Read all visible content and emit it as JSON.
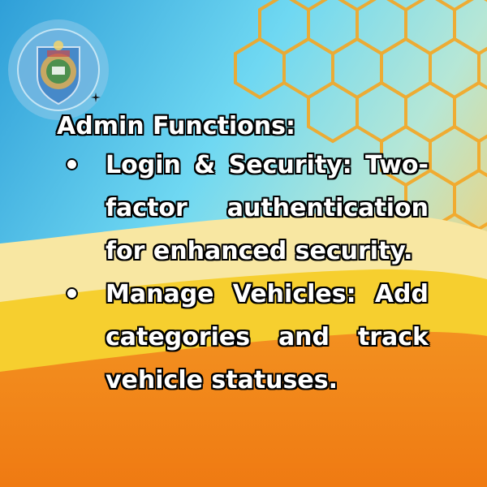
{
  "slide": {
    "heading": "Admin Functions:",
    "bullets": [
      {
        "text": "Login & Security: Two-factor authentication for enhanced security."
      },
      {
        "text": "Manage Vehicles: Add categories and track vehicle statuses."
      }
    ]
  },
  "logo": {
    "icon": "college-crest-icon"
  },
  "colors": {
    "top_blue": "#3fb1e6",
    "cyan": "#7fe1f4",
    "hex_outline": "#f5a623",
    "band_yellow": "#f7d23a",
    "band_cream": "#f8e8a6",
    "bottom_orange": "#f07e17",
    "text": "#ffffff",
    "text_outline": "#000000"
  }
}
